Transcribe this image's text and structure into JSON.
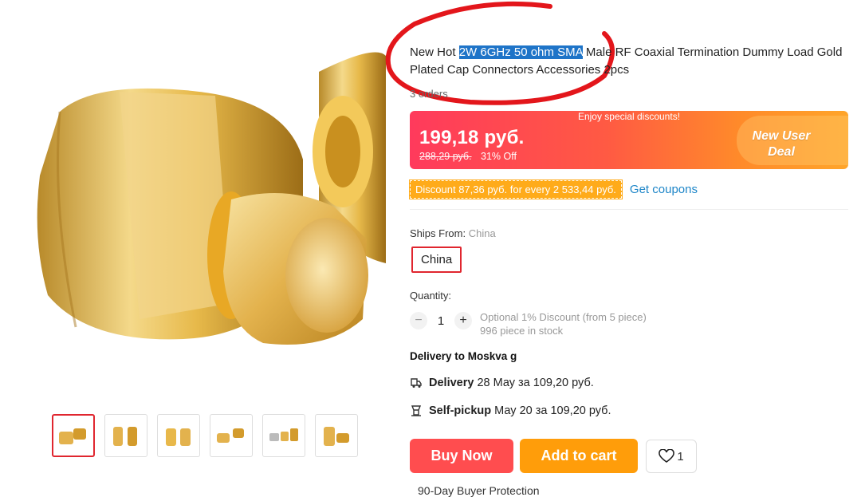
{
  "product": {
    "title_before": "New Hot ",
    "title_highlight": "2W 6GHz 50 ohm SMA",
    "title_after": " Male RF Coaxial Termination Dummy Load Gold Plated Cap Connectors Accessories 2pcs",
    "orders": "3 orders"
  },
  "price": {
    "banner_label": "Enjoy special discounts!",
    "current": "199,18 руб.",
    "original": "288,29 руб.",
    "discount": "31% Off",
    "deal_line1": "New User",
    "deal_line2": "Deal"
  },
  "coupon": {
    "tag": "Discount 87,36 руб. for every 2 533,44 руб.",
    "link": "Get coupons"
  },
  "shipping": {
    "label": "Ships From:",
    "value": "China",
    "option": "China"
  },
  "quantity": {
    "label": "Quantity:",
    "minus": "−",
    "value": "1",
    "plus": "+",
    "note1": "Optional 1% Discount (from 5 piece)",
    "note2": "996 piece in stock"
  },
  "delivery": {
    "heading": "Delivery to Moskva g",
    "delivery_label": "Delivery",
    "delivery_value": "28 Мау за 109,20 руб.",
    "pickup_label": "Self-pickup",
    "pickup_value": "Мау 20 за 109,20 руб."
  },
  "actions": {
    "buy_now": "Buy Now",
    "add_to_cart": "Add to cart",
    "wishlist_count": "1"
  },
  "footer_partial": "90-Day Buyer Protection",
  "colors": {
    "accent_red": "#e0262f",
    "buy_now": "#ff4d4f",
    "add_to_cart": "#ff9d0a",
    "link_blue": "#1e86c8",
    "coupon_orange": "#ffab1a"
  }
}
